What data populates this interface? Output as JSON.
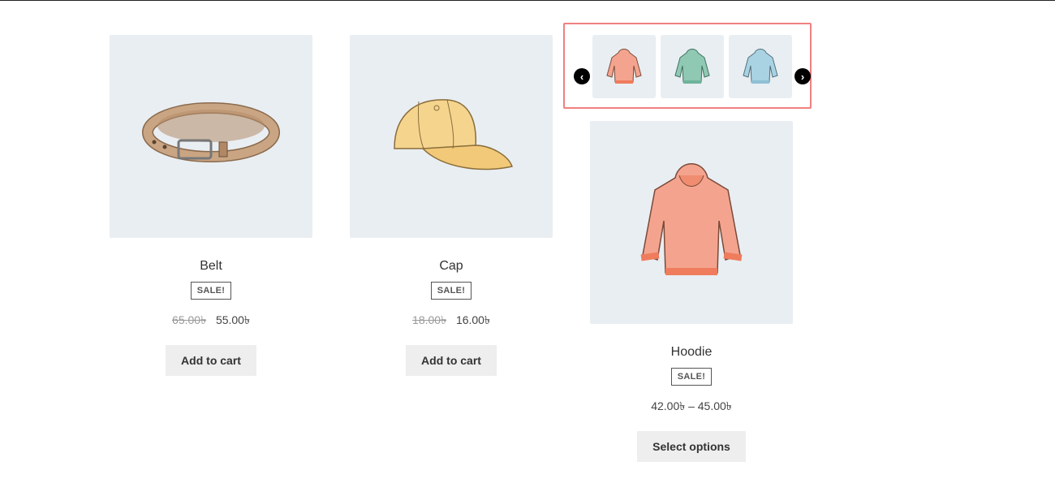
{
  "products": [
    {
      "title": "Belt",
      "sale_badge": "SALE!",
      "price_old": "65.00৳",
      "price_new": "55.00৳",
      "button_label": "Add to cart",
      "image_icon": "belt-icon"
    },
    {
      "title": "Cap",
      "sale_badge": "SALE!",
      "price_old": "18.00৳",
      "price_new": "16.00৳",
      "button_label": "Add to cart",
      "image_icon": "cap-icon"
    },
    {
      "title": "Hoodie",
      "sale_badge": "SALE!",
      "price_range": "42.00৳ – 45.00৳",
      "button_label": "Select options",
      "image_icon": "hoodie-icon"
    }
  ],
  "carousel": {
    "prev_icon": "chevron-left-icon",
    "next_icon": "chevron-right-icon",
    "thumbnails": [
      {
        "variant": "pink",
        "color": "#f4a48e"
      },
      {
        "variant": "green",
        "color": "#8fc9b3"
      },
      {
        "variant": "blue",
        "color": "#a9d2e2"
      }
    ]
  },
  "colors": {
    "highlight_border": "#f08080",
    "image_bg": "#e9eef2",
    "button_bg": "#eeeeee"
  }
}
